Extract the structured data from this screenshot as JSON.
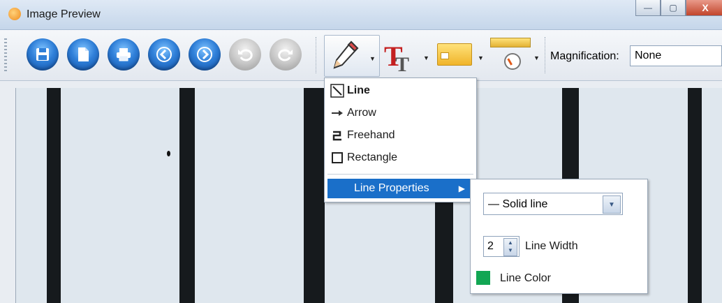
{
  "window": {
    "title": "Image Preview",
    "controls": {
      "minimize": "—",
      "maximize": "▢",
      "close": "X"
    }
  },
  "toolbar": {
    "buttons": [
      {
        "name": "save",
        "icon": "floppy-disk-icon",
        "style": "blue",
        "glyph": "💾"
      },
      {
        "name": "copy",
        "icon": "document-icon",
        "style": "blue",
        "glyph": "▭"
      },
      {
        "name": "print",
        "icon": "printer-icon",
        "style": "blue",
        "glyph": "▤"
      },
      {
        "name": "previous",
        "icon": "arrow-left-icon",
        "style": "blue",
        "glyph": "❮"
      },
      {
        "name": "next",
        "icon": "arrow-right-icon",
        "style": "blue",
        "glyph": "❯"
      },
      {
        "name": "undo",
        "icon": "undo-icon",
        "style": "gray",
        "glyph": "↶"
      },
      {
        "name": "redo",
        "icon": "redo-icon",
        "style": "gray",
        "glyph": "↷"
      }
    ],
    "magnification_label": "Magnification:",
    "magnification_value": "None"
  },
  "draw_menu": {
    "items": [
      {
        "label": "Line",
        "icon": "line-tool-icon",
        "bold": true
      },
      {
        "label": "Arrow",
        "icon": "arrow-tool-icon",
        "bold": false
      },
      {
        "label": "Freehand",
        "icon": "freehand-tool-icon",
        "bold": false
      },
      {
        "label": "Rectangle",
        "icon": "rectangle-tool-icon",
        "bold": false
      }
    ],
    "properties_label": "Line Properties"
  },
  "line_properties": {
    "style_value": "Solid line",
    "width_value": "2",
    "width_label": "Line Width",
    "color_label": "Line Color",
    "color": "#12a653"
  },
  "colors": {
    "selection": "#1a6fc9",
    "canvas": "#dfe7ee",
    "marks": "#161a1d"
  }
}
